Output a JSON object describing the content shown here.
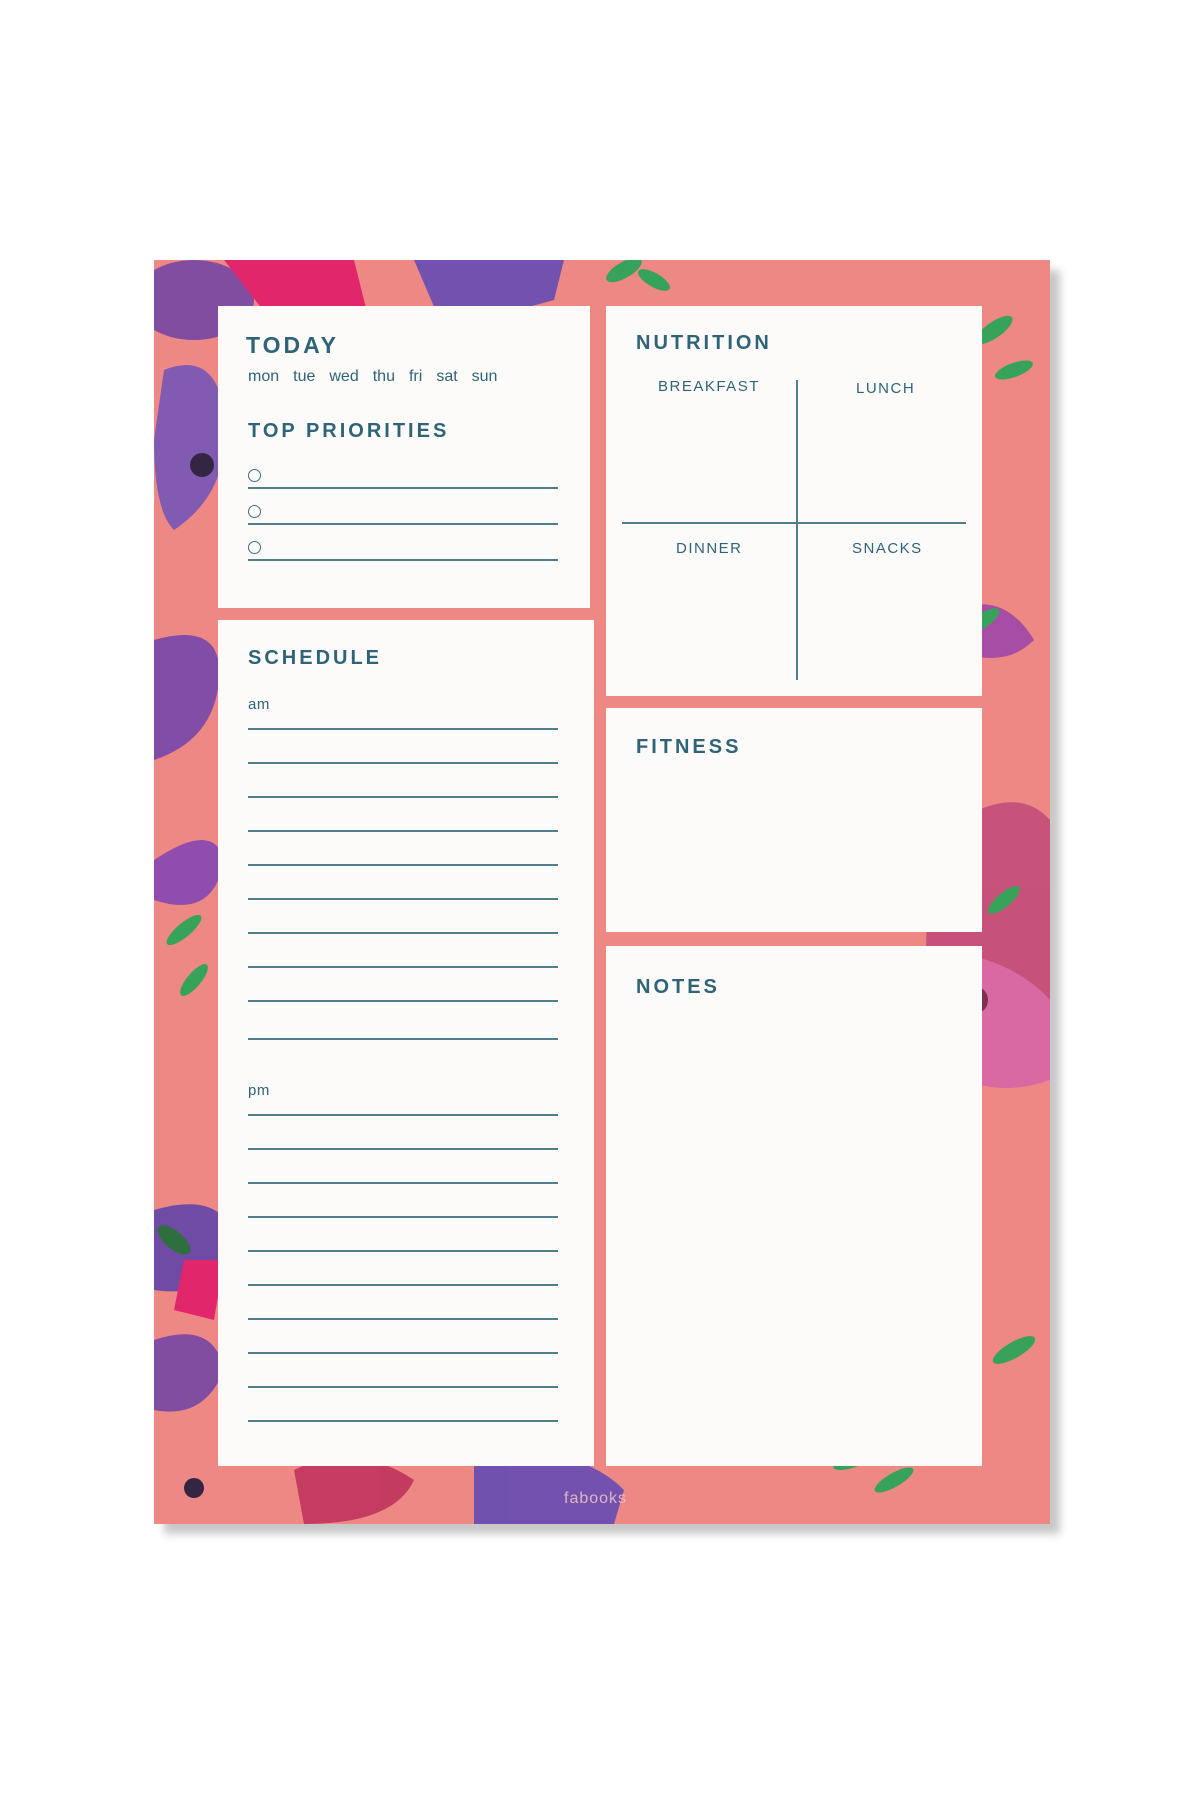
{
  "today": {
    "title": "TODAY",
    "days": [
      "mon",
      "tue",
      "wed",
      "thu",
      "fri",
      "sat",
      "sun"
    ],
    "priorities_title": "TOP PRIORITIES"
  },
  "schedule": {
    "title": "SCHEDULE",
    "am": "am",
    "pm": "pm"
  },
  "nutrition": {
    "title": "NUTRITION",
    "breakfast": "BREAKFAST",
    "lunch": "LUNCH",
    "dinner": "DINNER",
    "snacks": "SNACKS"
  },
  "fitness": {
    "title": "FITNESS"
  },
  "notes": {
    "title": "NOTES"
  },
  "brand": "fabooks",
  "colors": {
    "background": "#ee8884",
    "card": "#fdfafa",
    "text": "#2f6478"
  }
}
